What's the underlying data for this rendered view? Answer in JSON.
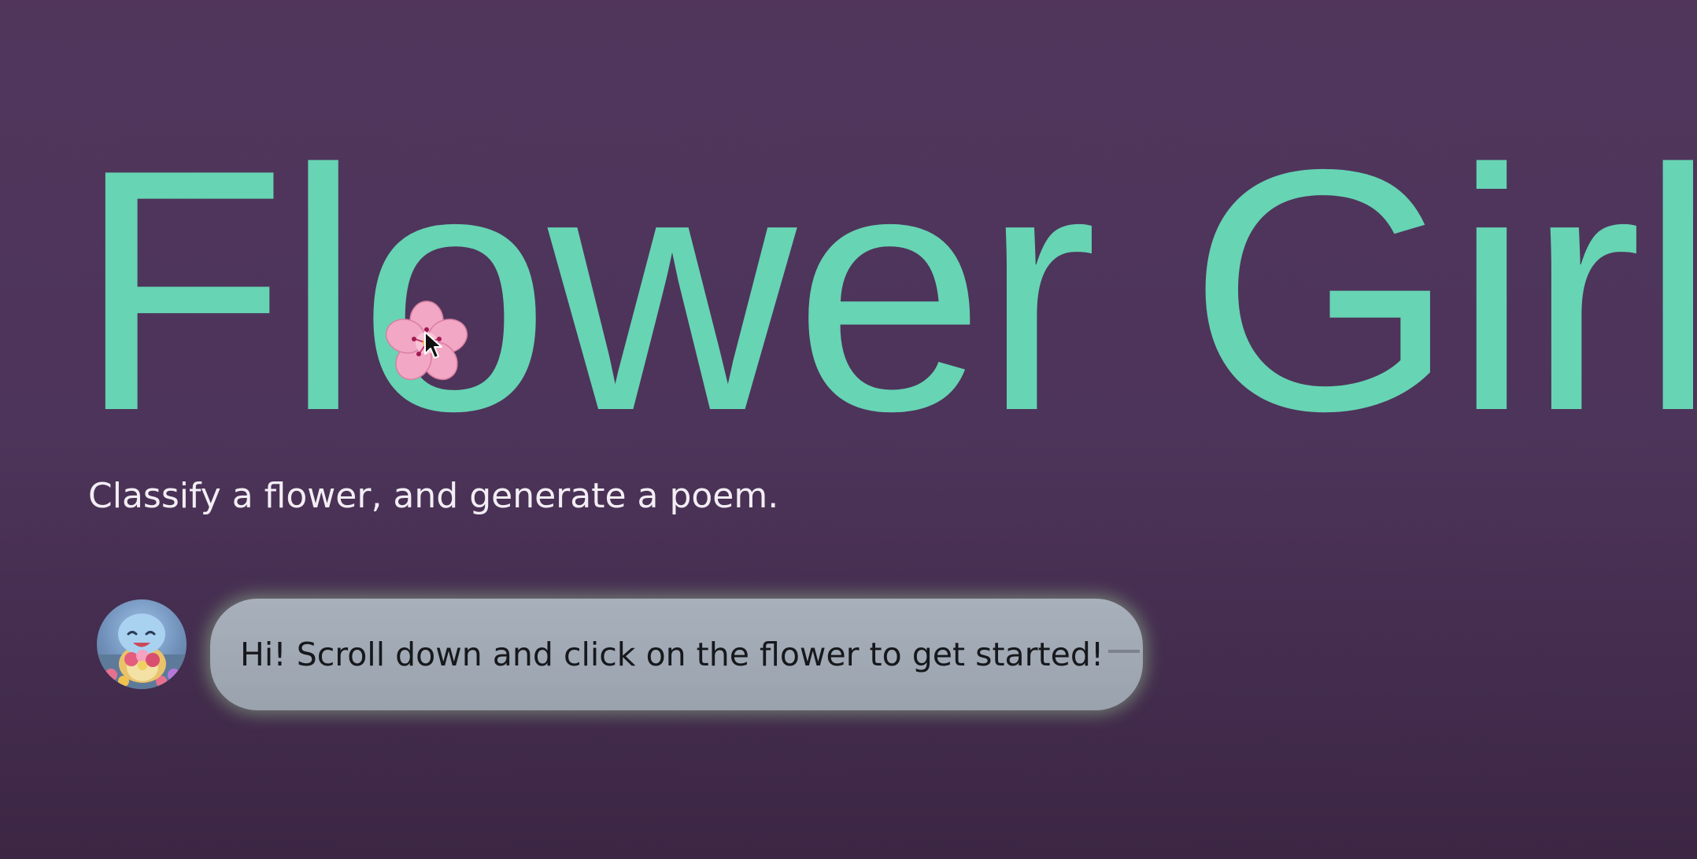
{
  "hero": {
    "title": "Flower Girl",
    "subtitle": "Classify a flower, and generate a poem."
  },
  "chat": {
    "message": "Hi! Scroll down and click on the flower to get started!"
  },
  "icons": {
    "flower": "cherry-blossom-icon",
    "cursor": "mouse-pointer-icon",
    "avatar": "squirtle-avatar"
  },
  "colors": {
    "background": "#51365c",
    "title": "#67d4b4",
    "subtitle": "#f3eef4",
    "bubble": "#a3abb6",
    "bubble_glow": "#aae6a0",
    "flower_petal": "#f2a7c4"
  }
}
